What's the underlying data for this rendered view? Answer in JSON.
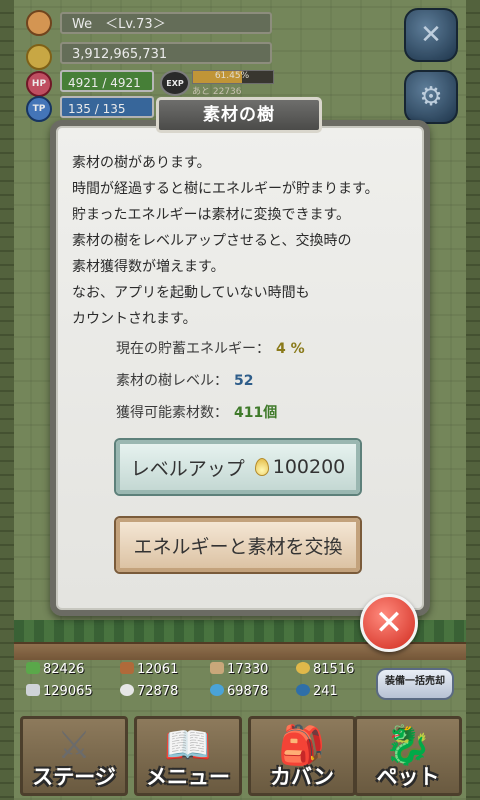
{
  "player": {
    "name_level": "We　＜Lv.73＞",
    "gold": "3,912,965,731",
    "hp": "4921 / 4921",
    "tp": "135 / 135",
    "hp_badge": "HP",
    "tp_badge": "TP",
    "exp_badge": "EXP",
    "exp_percent": "61.45%",
    "exp_fraction": 0.6145,
    "exp_next": "あと 22736"
  },
  "header": {
    "close_glyph": "✕",
    "settings_glyph": "⚙"
  },
  "dialog": {
    "title": "素材の樹",
    "description": [
      "素材の樹があります。",
      "時間が経過すると樹にエネルギーが貯まります。",
      "貯まったエネルギーは素材に変換できます。",
      "素材の樹をレベルアップさせると、交換時の",
      "素材獲得数が増えます。",
      "なお、アプリを起動していない時間も",
      "カウントされます。"
    ],
    "stats": {
      "energy_label": "現在の貯蓄エネルギー：",
      "energy_value": "4 %",
      "tree_level_label": "素材の樹レベル：",
      "tree_level_value": "52",
      "obtainable_label": "獲得可能素材数：",
      "obtainable_value": "411個"
    },
    "levelup_label": "レベルアップ",
    "levelup_cost": "100200",
    "exchange_label": "エネルギーと素材を交換",
    "close_glyph": "✕"
  },
  "resources": [
    {
      "icon": "herb-icon",
      "value": "82426",
      "color": "#5aa84a"
    },
    {
      "icon": "wood-icon",
      "value": "12061",
      "color": "#b06a3a"
    },
    {
      "icon": "branch-icon",
      "value": "17330",
      "color": "#c9a77a"
    },
    {
      "icon": "drop-icon",
      "value": "81516",
      "color": "#e0b84a"
    },
    {
      "icon": "ingot-icon",
      "value": "129065",
      "color": "#cfd3d8"
    },
    {
      "icon": "ore-icon",
      "value": "72878",
      "color": "#e6e6e6"
    },
    {
      "icon": "crystal-icon",
      "value": "69878",
      "color": "#4aa3d8"
    },
    {
      "icon": "orb-icon",
      "value": "241",
      "color": "#2f6fa8"
    }
  ],
  "sell_all_label": "装備一括売却",
  "nav": [
    {
      "label": "ステージ",
      "icon": "crossed-swords-icon",
      "glyph": "⚔"
    },
    {
      "label": "メニュー",
      "icon": "book-icon",
      "glyph": "📖"
    },
    {
      "label": "カバン",
      "icon": "backpack-icon",
      "glyph": "🎒"
    },
    {
      "label": "ペット",
      "icon": "dragon-icon",
      "glyph": "🐉"
    }
  ]
}
